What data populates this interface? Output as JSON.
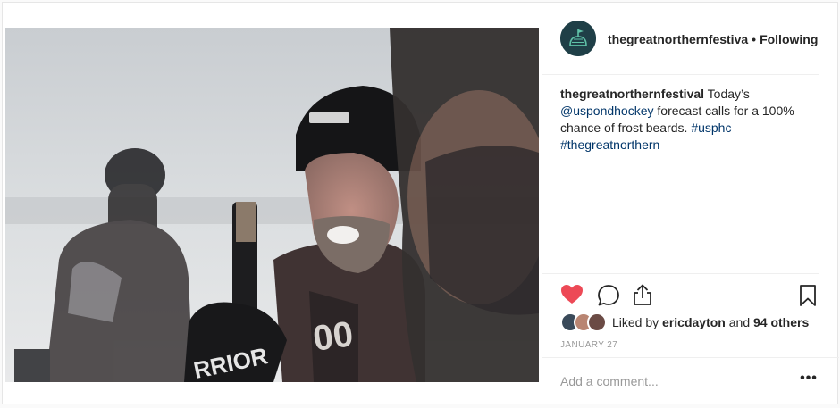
{
  "post": {
    "username": "thegreatnorthernfestiva",
    "separator": "•",
    "follow_status": "Following",
    "caption": {
      "author": "thegreatnorthernfestival",
      "text_1": " Today’s ",
      "mention": "@uspondhockey",
      "text_2": " forecast calls for a 100% chance of frost beards. ",
      "hashtag_1": "#usphc",
      "hashtag_2": "#thegreatnorthern"
    },
    "likes": {
      "prefix": "Liked by ",
      "user": "ericdayton",
      "middle": " and ",
      "others": "94 others"
    },
    "date": "JANUARY 27",
    "comment_placeholder": "Add a comment...",
    "more_label": "•••",
    "photo_alt": "Pond hockey players in the snow"
  },
  "icons": {
    "avatar": "flag-on-dome-logo",
    "like": "heart-icon",
    "comment": "comment-bubble-icon",
    "share": "share-icon",
    "save": "bookmark-icon"
  },
  "colors": {
    "like_red": "#ed4956",
    "link_blue": "#003569",
    "avatar_bg": "#1f3f47",
    "avatar_fg": "#5fc2a8"
  }
}
